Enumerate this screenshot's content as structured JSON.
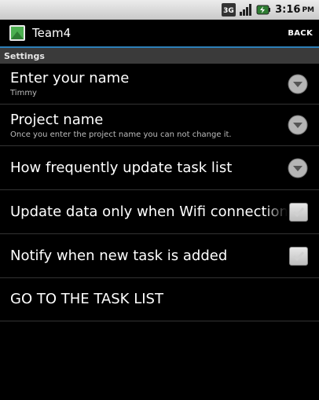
{
  "status_bar": {
    "network": "3G",
    "time": "3:16",
    "ampm": "PM"
  },
  "title_bar": {
    "app_title": "Team4",
    "back_label": "BACK",
    "accent_color": "#2d7fb8"
  },
  "section": {
    "title": "Settings"
  },
  "preferences": [
    {
      "title": "Enter your name",
      "summary": "Timmy",
      "widget": "dropdown-icon"
    },
    {
      "title": "Project name",
      "summary": "Once you enter the project name you can not change it.",
      "widget": "dropdown-icon"
    },
    {
      "title": "How frequently update task list",
      "summary": "",
      "widget": "dropdown-icon"
    },
    {
      "title": "Update data only when Wifi connection is",
      "summary": "",
      "widget": "checkbox",
      "checked": true
    },
    {
      "title": "Notify when new task is added",
      "summary": "",
      "widget": "checkbox",
      "checked": true
    },
    {
      "title": "GO TO THE TASK LIST",
      "summary": "",
      "widget": "none"
    }
  ]
}
